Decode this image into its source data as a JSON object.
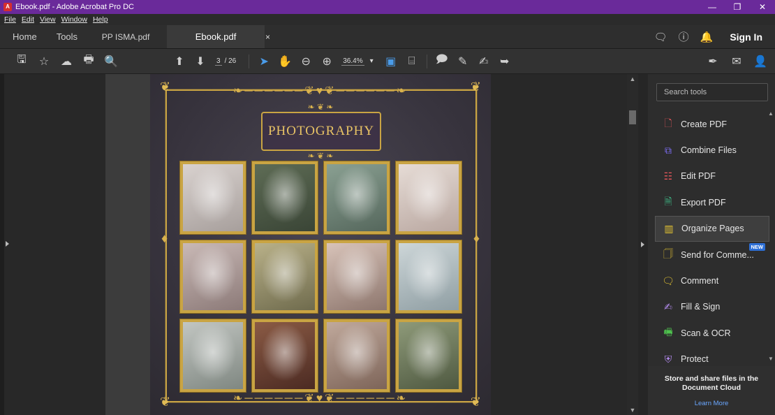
{
  "window": {
    "title": "Ebook.pdf - Adobe Acrobat Pro DC",
    "controls": [
      "—",
      "❐",
      "✕"
    ]
  },
  "menu": [
    "File",
    "Edit",
    "View",
    "Window",
    "Help"
  ],
  "tabs": {
    "home": "Home",
    "tools": "Tools",
    "doc1": "PP ISMA.pdf",
    "doc2": "Ebook.pdf",
    "close": "×"
  },
  "account": {
    "signin": "Sign In"
  },
  "toolbar": {
    "page_current": "3",
    "page_total": "/ 26",
    "zoom": "36.4%",
    "zoom_caret": "▾"
  },
  "document": {
    "cover_title": "PHOTOGRAPHY",
    "photo_count": 12
  },
  "tools_pane": {
    "search_placeholder": "Search tools",
    "items": [
      {
        "label": "Create PDF",
        "icon": "create-pdf-icon",
        "color": "#e8575c"
      },
      {
        "label": "Combine Files",
        "icon": "combine-files-icon",
        "color": "#7b6cf0"
      },
      {
        "label": "Edit PDF",
        "icon": "edit-pdf-icon",
        "color": "#e8575c"
      },
      {
        "label": "Export PDF",
        "icon": "export-pdf-icon",
        "color": "#3fbf8a"
      },
      {
        "label": "Organize Pages",
        "icon": "organize-pages-icon",
        "color": "#e6c532"
      },
      {
        "label": "Send for Comme...",
        "icon": "send-for-comment-icon",
        "color": "#e6c532",
        "badge": "NEW"
      },
      {
        "label": "Comment",
        "icon": "comment-icon",
        "color": "#e6c532"
      },
      {
        "label": "Fill & Sign",
        "icon": "fill-sign-icon",
        "color": "#b58cf0"
      },
      {
        "label": "Scan & OCR",
        "icon": "scan-ocr-icon",
        "color": "#4ec24e"
      },
      {
        "label": "Protect",
        "icon": "protect-icon",
        "color": "#b58cf0"
      }
    ],
    "cloud_heading": "Store and share files in the Document Cloud",
    "cloud_link": "Learn More"
  },
  "colors": {
    "titlebar": "#6a2a9a",
    "accent": "#4a9be8",
    "gold": "#c9a443"
  }
}
